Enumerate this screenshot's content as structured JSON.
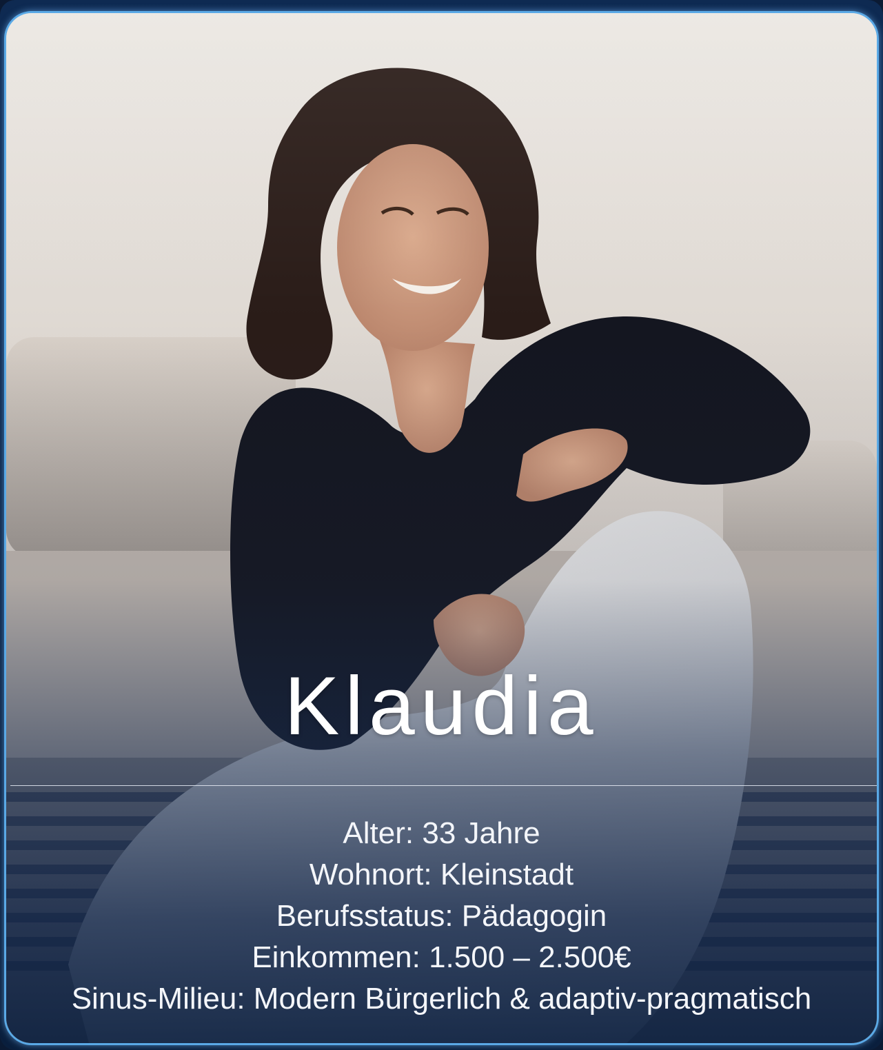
{
  "persona": {
    "name": "Klaudia",
    "facts": [
      "Alter: 33 Jahre",
      "Wohnort: Kleinstadt",
      "Berufsstatus: Pädagogin",
      "Einkommen: 1.500 – 2.500€",
      "Sinus-Milieu: Modern Bürgerlich & adaptiv-pragmatisch"
    ]
  },
  "colors": {
    "frame_border": "#5aa9e6",
    "overlay": "#0a1f3d",
    "text": "#ffffff"
  }
}
